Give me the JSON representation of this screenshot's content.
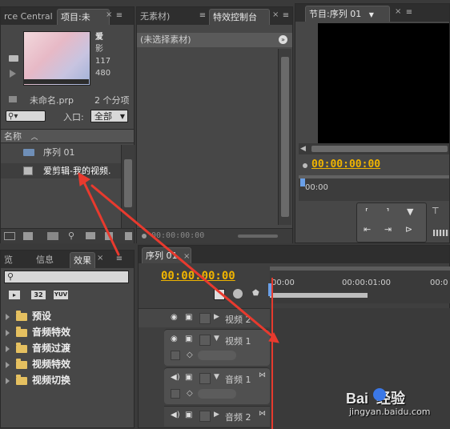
{
  "source_panel": {
    "tab_source": "rce Central",
    "tab_project": "项目:未",
    "clip_name_short": "爱",
    "clip_line2": "影",
    "clip_line3": "117",
    "clip_line4": "480",
    "project_file": "未命名.prp",
    "item_count": "2 个分项",
    "entry_label": "入口:",
    "entry_value": "全部",
    "col_name": "名称",
    "items": [
      {
        "label": "序列 01"
      },
      {
        "label": "爱剪辑-我的视频."
      }
    ]
  },
  "effect_control_panel": {
    "tab_source_partial": "无素材)",
    "tab_effects_control": "特效控制台",
    "header": "(未选择素材)",
    "timecode": "00:00:00:00"
  },
  "program_monitor": {
    "tab": "节目:序列 01",
    "timecode": "00:00:00:00",
    "ruler_time": "00:00"
  },
  "effects_panel": {
    "tab_preview": "览",
    "tab_info": "信息",
    "tab_effects": "效果",
    "badge_32": "32",
    "badge_yuv": "YUV",
    "folders": [
      {
        "label": "预设"
      },
      {
        "label": "音频特效"
      },
      {
        "label": "音频过渡"
      },
      {
        "label": "视频特效"
      },
      {
        "label": "视频切换"
      }
    ]
  },
  "timeline": {
    "tab": "序列 01",
    "timecode": "00:00:00:00",
    "ruler_t0": "00:00",
    "ruler_t1": "00:00:01:00",
    "ruler_t2": "00:0",
    "tracks": [
      {
        "label": "视频 2"
      },
      {
        "label": "视频 1"
      },
      {
        "label": "音频 1"
      },
      {
        "label": "音频 2"
      }
    ]
  },
  "watermark": {
    "brand": "Bai  经验",
    "url": "jingyan.baidu.com"
  },
  "colors": {
    "timecode": "#f0b400",
    "arrow": "#e83a2e",
    "playhead": "#e63a2e",
    "folder": "#e5c060"
  }
}
